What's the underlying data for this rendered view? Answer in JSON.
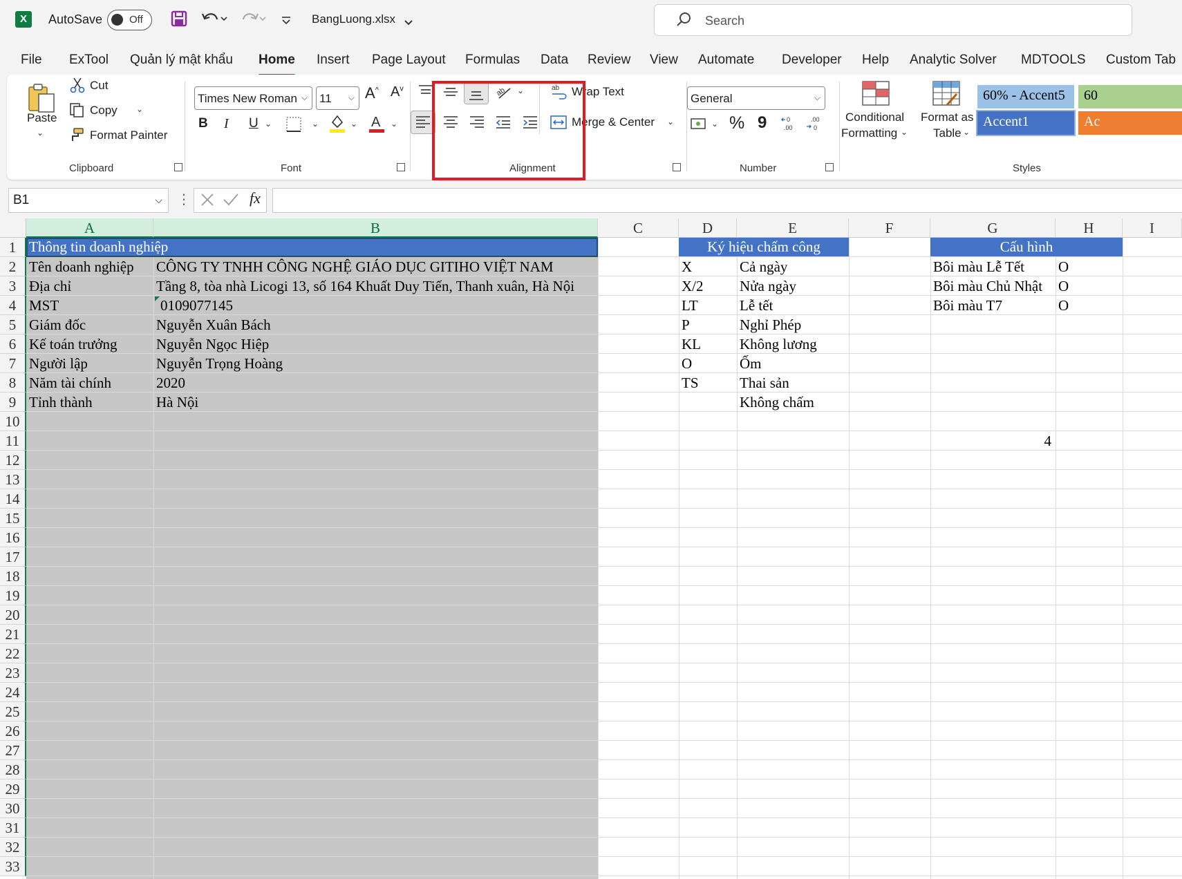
{
  "titlebar": {
    "autosave_label": "AutoSave",
    "toggle_state": "Off",
    "filename": "BangLuong.xlsx",
    "search_placeholder": "Search"
  },
  "tabs": [
    "File",
    "ExTool",
    "Quản lý mật khẩu",
    "Home",
    "Insert",
    "Page Layout",
    "Formulas",
    "Data",
    "Review",
    "View",
    "Automate",
    "Developer",
    "Help",
    "Analytic Solver",
    "MDTOOLS",
    "Custom Tab"
  ],
  "active_tab": "Home",
  "ribbon": {
    "clipboard": {
      "paste": "Paste",
      "cut": "Cut",
      "copy": "Copy",
      "format_painter": "Format Painter",
      "label": "Clipboard"
    },
    "font": {
      "font_name": "Times New Roman",
      "font_size": "11",
      "label": "Font",
      "bold": "B",
      "italic": "I",
      "underline": "U"
    },
    "alignment": {
      "wrap_text": "Wrap Text",
      "merge_center": "Merge & Center",
      "label": "Alignment"
    },
    "number": {
      "format": "General",
      "percent": "%",
      "comma": "9",
      "label": "Number"
    },
    "styles": {
      "conditional": "Conditional",
      "formatting": "Formatting",
      "format_as": "Format as",
      "table": "Table",
      "style1": "60% - Accent5",
      "style2": "60",
      "style3": "Accent1",
      "style4": "Ac",
      "label": "Styles"
    }
  },
  "formula_bar": {
    "name_box": "B1",
    "fx": "fx",
    "formula": ""
  },
  "columns": [
    {
      "name": "A",
      "selected": true
    },
    {
      "name": "B",
      "selected": true
    },
    {
      "name": "C"
    },
    {
      "name": "D"
    },
    {
      "name": "E"
    },
    {
      "name": "F"
    },
    {
      "name": "G"
    },
    {
      "name": "H"
    },
    {
      "name": "I"
    }
  ],
  "rows": [
    "1",
    "2",
    "3",
    "4",
    "5",
    "6",
    "7",
    "8",
    "9",
    "10",
    "11",
    "12",
    "13",
    "14",
    "15",
    "16",
    "17",
    "18",
    "19",
    "20",
    "21",
    "22",
    "23",
    "24",
    "25",
    "26",
    "27",
    "28",
    "29",
    "30",
    "31",
    "32",
    "33"
  ],
  "cells": {
    "A1": "Thông tin doanh nghiệp",
    "A2": "Tên doanh nghiệp",
    "B2": "CÔNG TY TNHH CÔNG NGHỆ GIÁO DỤC GITIHO VIỆT NAM",
    "A3": "Địa chỉ",
    "B3": "Tầng 8, tòa nhà Licogi 13, số 164 Khuất Duy Tiến, Thanh xuân, Hà Nội",
    "A4": "MST",
    "B4": "0109077145",
    "A5": "Giám đốc",
    "B5": "Nguyễn Xuân Bách",
    "A6": "Kế toán trưởng",
    "B6": "Nguyễn Ngọc Hiệp",
    "A7": "Người lập",
    "B7": "Nguyễn Trọng Hoàng",
    "A8": "Năm tài chính",
    "B8": "2020",
    "A9": "Tỉnh thành",
    "B9": "Hà Nội",
    "D1": "Ký hiệu chấm công",
    "D2": "X",
    "E2": "Cả ngày",
    "D3": "X/2",
    "E3": "Nửa ngày",
    "D4": "LT",
    "E4": "Lễ tết",
    "D5": "P",
    "E5": "Nghỉ Phép",
    "D6": "KL",
    "E6": "Không lương",
    "D7": "O",
    "E7": "Ốm",
    "D8": "TS",
    "E8": "Thai sản",
    "E9": "Không chấm",
    "G1": "Cấu hình",
    "G2": "Bôi màu Lễ Tết",
    "H2": "O",
    "G3": "Bôi màu Chủ Nhật",
    "H3": "O",
    "G4": "Bôi màu T7",
    "H4": "O",
    "G11": "4"
  },
  "colors": {
    "accent_green": "#107c41",
    "header_blue": "#4472c4",
    "highlight_red": "#e21b23",
    "selection_gray": "#c6c6c6"
  }
}
